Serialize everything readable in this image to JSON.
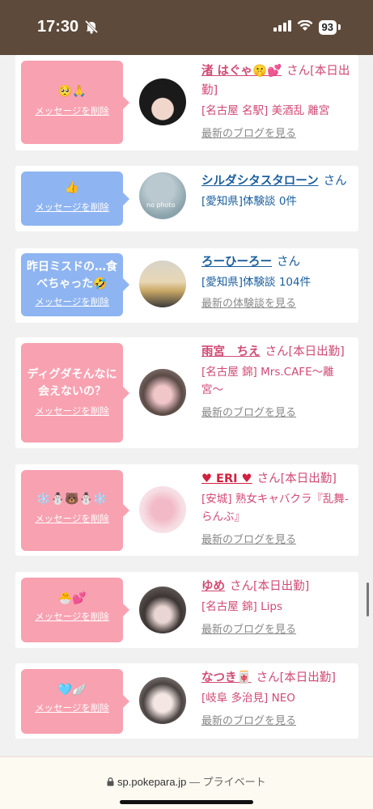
{
  "status": {
    "time": "17:30",
    "battery": "93"
  },
  "cards": [
    {
      "msg": "🥺🙏",
      "delete": "メッセージを削除",
      "name": "渚 はぐゃ🤫💕",
      "san": "さん",
      "tag": "[本日出勤]",
      "shop": "[名古屋 名駅] 美酒乱 離宮",
      "latest": "最新のブログを見る"
    },
    {
      "msg": "👍",
      "delete": "メッセージを削除",
      "name": "シルダシタスタローン",
      "san": "さん",
      "tag": "",
      "shop": "[愛知県]体験談 0件",
      "latest": ""
    },
    {
      "msg": "昨日ミスドの…食べちゃった🤣",
      "delete": "メッセージを削除",
      "name": "ろーひーろー",
      "san": "さん",
      "tag": "",
      "shop": "[愛知県]体験談 104件",
      "latest": "最新の体験談を見る"
    },
    {
      "msg": "ディグダそんなに会えないの？",
      "delete": "メッセージを削除",
      "name": "雨宮　ちえ",
      "san": "さん",
      "tag": "[本日出勤]",
      "shop": "[名古屋 錦] Mrs.CAFE〜離宮〜",
      "latest": "最新のブログを見る"
    },
    {
      "msg": "❄️⛄🐻⛄❄️",
      "delete": "メッセージを削除",
      "name": "♥ ERI ♥",
      "san": "さん",
      "tag": "[本日出勤]",
      "shop": "[安城] 熟女キャバクラ『乱舞-らんぶ』",
      "latest": "最新のブログを見る"
    },
    {
      "msg": "🐣💕",
      "delete": "メッセージを削除",
      "name": "ゆめ",
      "san": "さん",
      "tag": "[本日出勤]",
      "shop": "[名古屋 錦] Lips",
      "latest": "最新のブログを見る"
    },
    {
      "msg": "🩵🪽",
      "delete": "メッセージを削除",
      "name": "なつき🀄",
      "san": "さん",
      "tag": "[本日出勤]",
      "shop": "[岐阜 多治見] NEO",
      "latest": "最新のブログを見る"
    }
  ],
  "avatar2_text": "no photo",
  "browser": {
    "url": "sp.pokepara.jp",
    "sep": "—",
    "mode": "プライベート"
  },
  "colors": {
    "pink": "#f8a1b1",
    "blue": "#8eb4f1",
    "name_pink": "#d14a74",
    "name_blue": "#1a5e9e",
    "status_bg": "#5e4a3a"
  }
}
